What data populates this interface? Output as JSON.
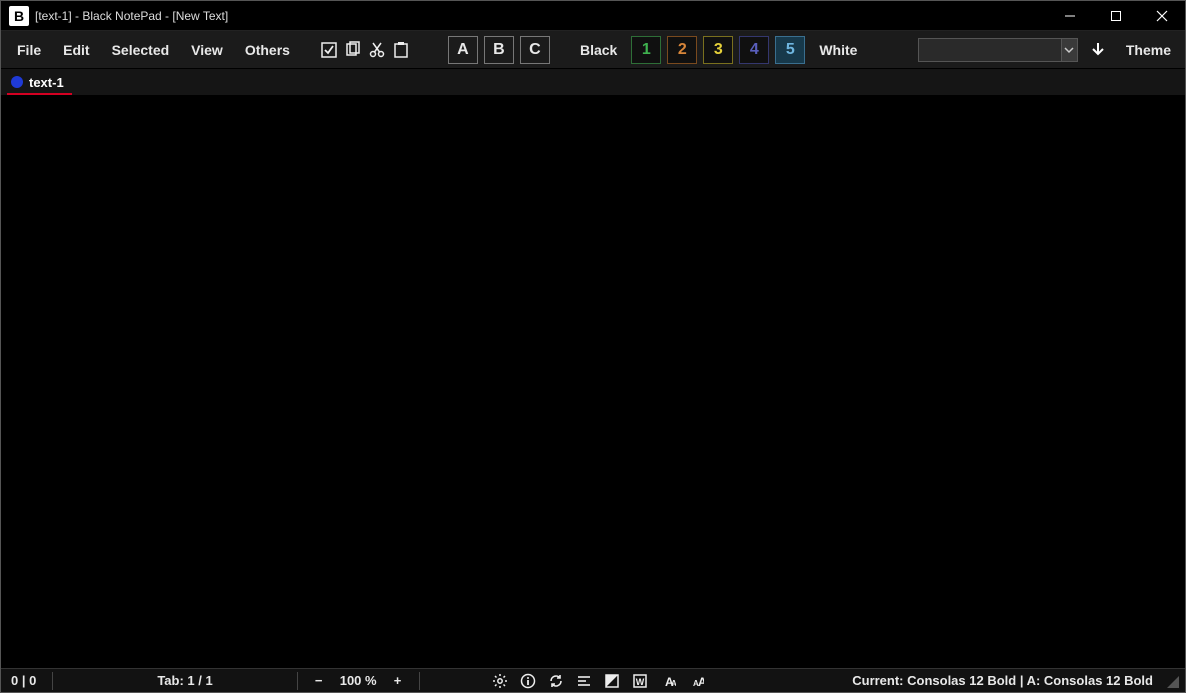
{
  "title": "[text-1] - Black NotePad - [New Text]",
  "menu": {
    "file": "File",
    "edit": "Edit",
    "selected": "Selected",
    "view": "View",
    "others": "Others"
  },
  "toolbar": {
    "letters": {
      "a": "A",
      "b": "B",
      "c": "C"
    },
    "black_label": "Black",
    "white_label": "White",
    "numbers": {
      "n1": "1",
      "n2": "2",
      "n3": "3",
      "n4": "4",
      "n5": "5"
    },
    "theme_button": "Theme",
    "font_value": ""
  },
  "tabs": {
    "t1": {
      "label": "text-1"
    }
  },
  "status": {
    "cursor": "0 | 0",
    "tab_indicator": "Tab: 1 / 1",
    "zoom": "100 %",
    "font_info": "Current: Consolas 12 Bold | A: Consolas 12 Bold"
  }
}
